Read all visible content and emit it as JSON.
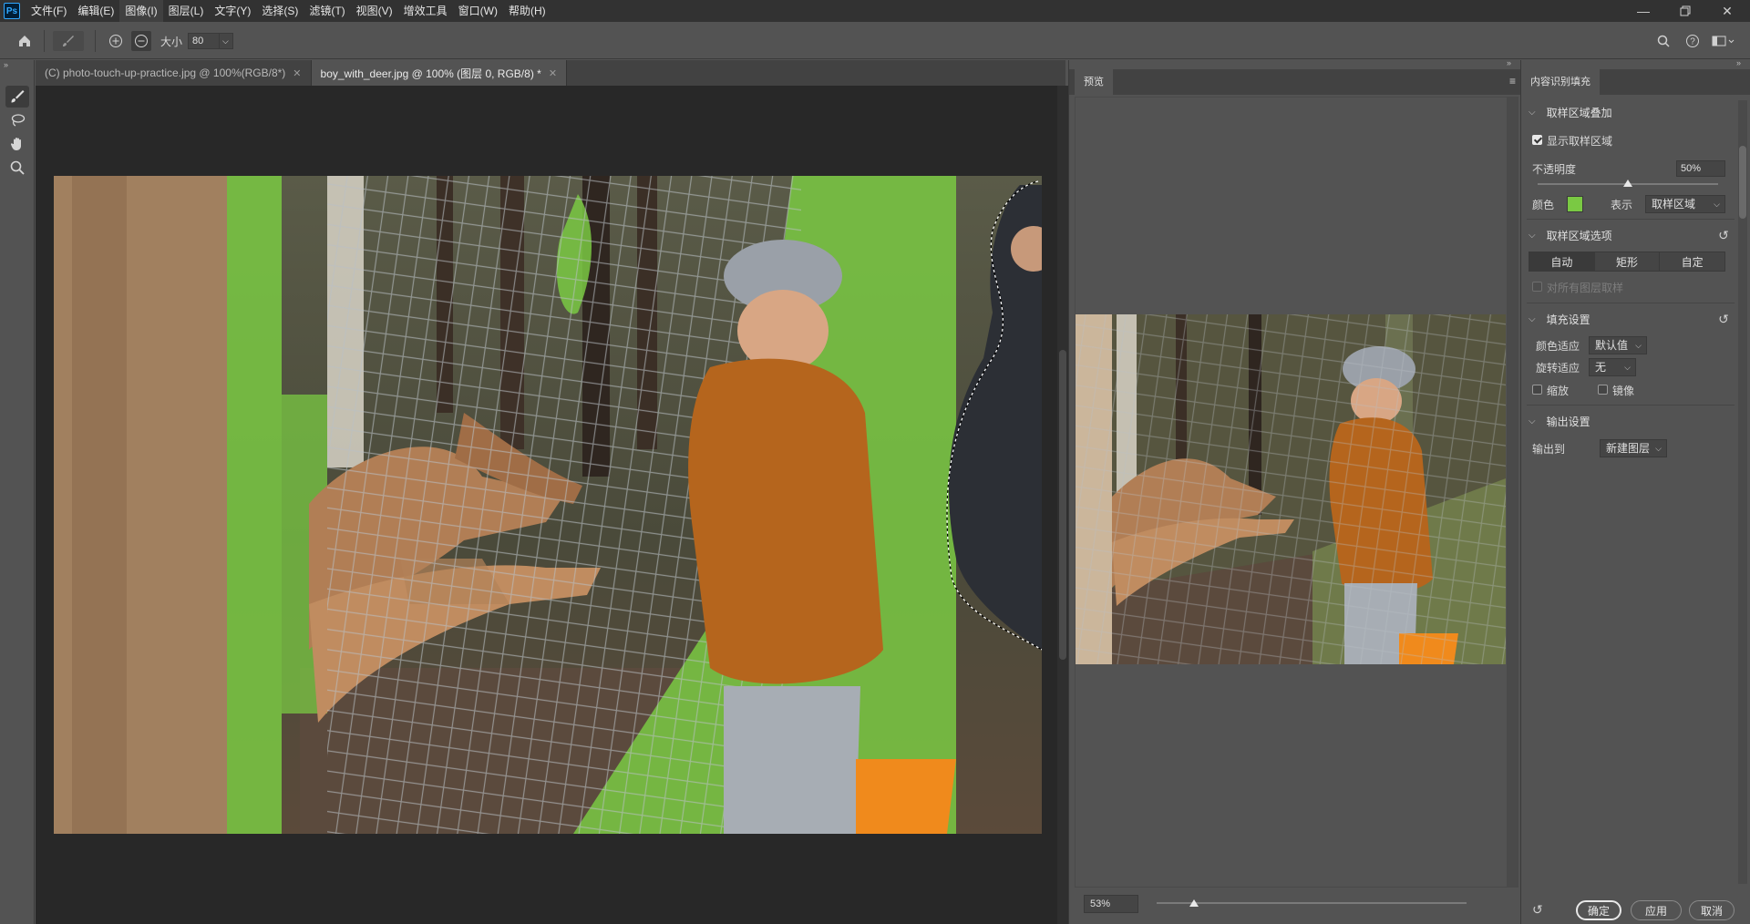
{
  "app": {
    "logo": "Ps",
    "menus": [
      "文件(F)",
      "编辑(E)",
      "图像(I)",
      "图层(L)",
      "文字(Y)",
      "选择(S)",
      "滤镜(T)",
      "视图(V)",
      "增效工具",
      "窗口(W)",
      "帮助(H)"
    ],
    "active_menu_index": 2
  },
  "options_bar": {
    "size_label": "大小",
    "size_value": "80"
  },
  "document_tabs": [
    {
      "label": "(C) photo-touch-up-practice.jpg @ 100%(RGB/8*)",
      "active": false
    },
    {
      "label": "boy_with_deer.jpg @ 100% (图层 0, RGB/8) *",
      "active": true
    }
  ],
  "preview": {
    "tab_label": "预览",
    "zoom_value": "53%",
    "zoom_fraction": 0.12
  },
  "content_aware_fill": {
    "tab_label": "内容识别填充",
    "sampling_overlay": {
      "title": "取样区域叠加",
      "show_sampling_label": "显示取样区域",
      "show_sampling_checked": true,
      "opacity_label": "不透明度",
      "opacity_value": "50%",
      "opacity_fraction": 0.5,
      "color_label": "颜色",
      "color_swatch": "#7ac943",
      "indicates_label": "表示",
      "indicates_value": "取样区域"
    },
    "sampling_options": {
      "title": "取样区域选项",
      "modes": [
        "自动",
        "矩形",
        "自定"
      ],
      "active_mode_index": 0,
      "sample_all_layers_label": "对所有图层取样"
    },
    "fill_settings": {
      "title": "填充设置",
      "color_adapt_label": "颜色适应",
      "color_adapt_value": "默认值",
      "rotation_adapt_label": "旋转适应",
      "rotation_adapt_value": "无",
      "scale_label": "缩放",
      "mirror_label": "镜像"
    },
    "output_settings": {
      "title": "输出设置",
      "output_to_label": "输出到",
      "output_to_value": "新建图层"
    },
    "buttons": {
      "ok": "确定",
      "apply": "应用",
      "cancel": "取消"
    }
  },
  "colors": {
    "sampling_green": "#7ac943",
    "jacket_orange": "#b5651d",
    "bucket_orange": "#f08a1c"
  }
}
